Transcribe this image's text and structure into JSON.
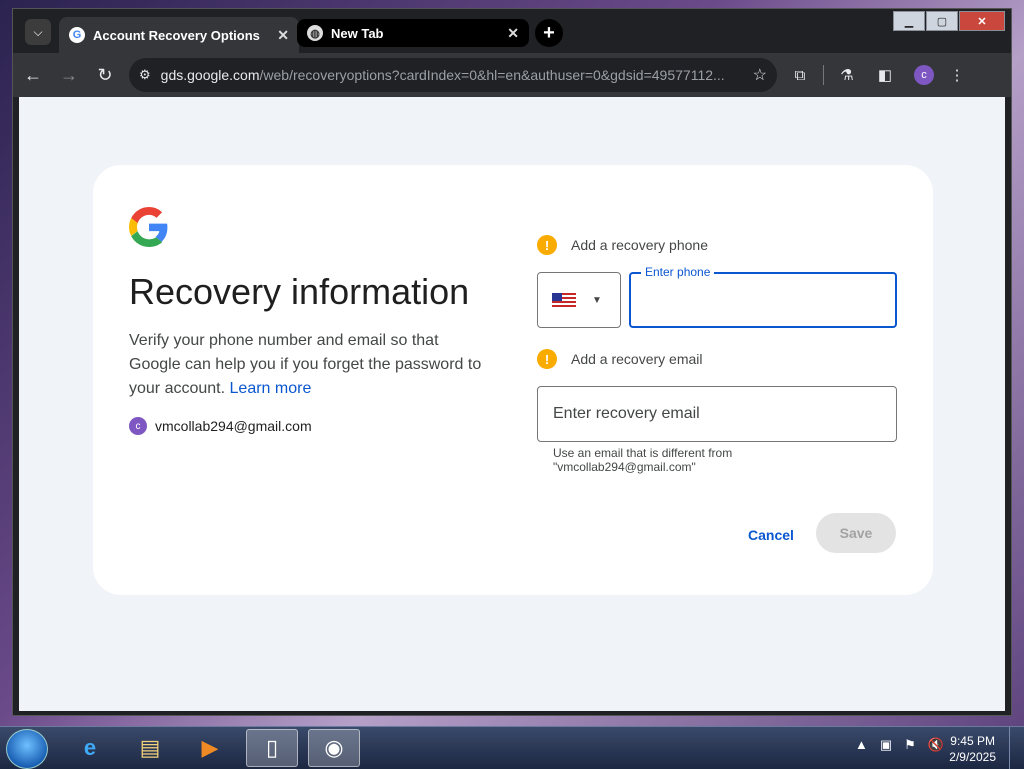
{
  "browser": {
    "tabs": [
      {
        "title": "Account Recovery Options",
        "active": true
      },
      {
        "title": "New Tab",
        "active": false
      }
    ],
    "url_host": "gds.google.com",
    "url_path": "/web/recoveryoptions?cardIndex=0&hl=en&authuser=0&gdsid=49577112...",
    "profile_initial": "c"
  },
  "page": {
    "heading": "Recovery information",
    "description": "Verify your phone number and email so that Google can help you if you forget the password to your account.",
    "learn_more": "Learn more",
    "account_email": "vmcollab294@gmail.com",
    "account_initial": "c",
    "phone_section_label": "Add a recovery phone",
    "phone_field_label": "Enter phone",
    "phone_value": "",
    "email_section_label": "Add a recovery email",
    "email_placeholder": "Enter recovery email",
    "email_hint_line1": "Use an email that is different from",
    "email_hint_line2": "\"vmcollab294@gmail.com\"",
    "cancel_label": "Cancel",
    "save_label": "Save"
  },
  "taskbar": {
    "time": "9:45 PM",
    "date": "2/9/2025"
  },
  "colors": {
    "accent": "#0b57d0",
    "warning": "#f9ab00",
    "page_bg": "#f0f4f9"
  }
}
